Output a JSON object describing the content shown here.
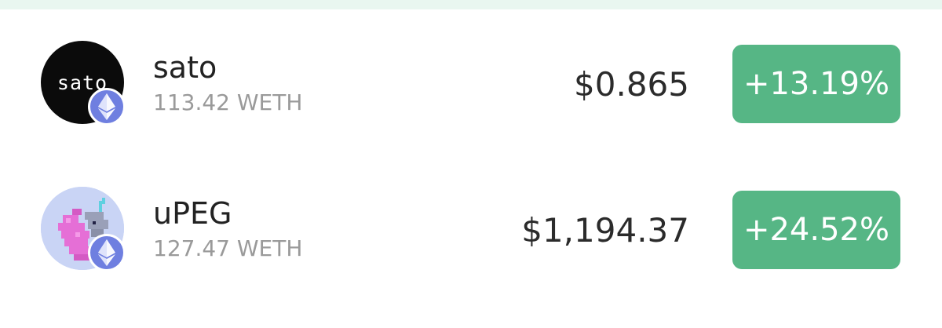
{
  "colors": {
    "positive": "#56b685",
    "chain_badge": "#6f7fe0",
    "top_strip": "#e9f6f0"
  },
  "rows": [
    {
      "avatar_text": "sato",
      "avatar_icon": "sato-logo",
      "chain_icon": "ethereum-icon",
      "name": "sato",
      "volume": "113.42 WETH",
      "price": "$0.865",
      "change": "+13.19%"
    },
    {
      "avatar_icon": "pixel-unicorn",
      "chain_icon": "ethereum-icon",
      "name": "uPEG",
      "volume": "127.47 WETH",
      "price": "$1,194.37",
      "change": "+24.52%"
    }
  ]
}
